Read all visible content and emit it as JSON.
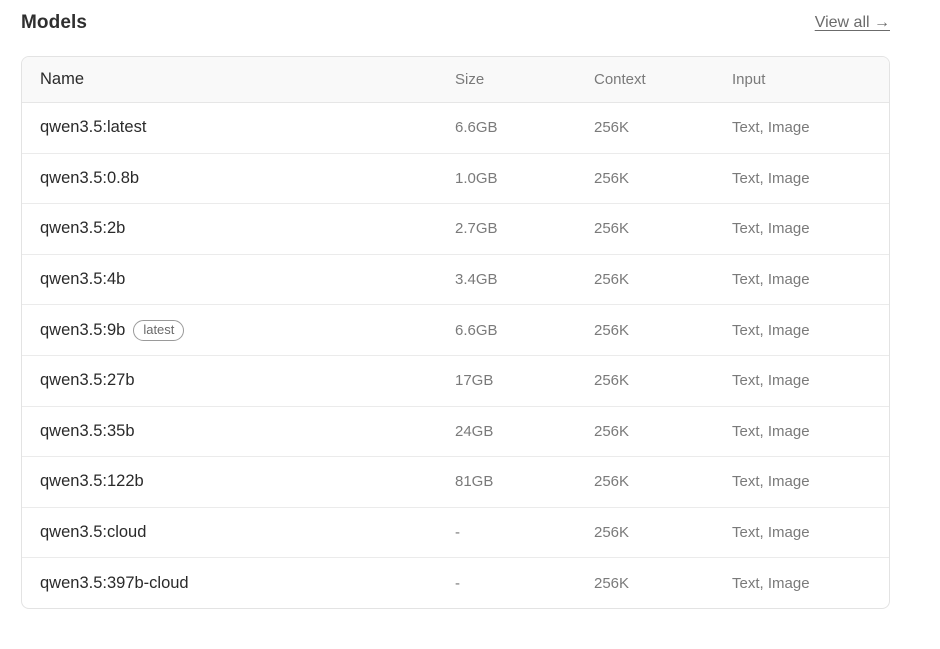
{
  "header": {
    "title": "Models",
    "view_all": "View all →"
  },
  "table": {
    "columns": [
      "Name",
      "Size",
      "Context",
      "Input"
    ],
    "rows": [
      {
        "name": "qwen3.5:latest",
        "badge": "",
        "size": "6.6GB",
        "context": "256K",
        "input": "Text, Image"
      },
      {
        "name": "qwen3.5:0.8b",
        "badge": "",
        "size": "1.0GB",
        "context": "256K",
        "input": "Text, Image"
      },
      {
        "name": "qwen3.5:2b",
        "badge": "",
        "size": "2.7GB",
        "context": "256K",
        "input": "Text, Image"
      },
      {
        "name": "qwen3.5:4b",
        "badge": "",
        "size": "3.4GB",
        "context": "256K",
        "input": "Text, Image"
      },
      {
        "name": "qwen3.5:9b",
        "badge": "latest",
        "size": "6.6GB",
        "context": "256K",
        "input": "Text, Image"
      },
      {
        "name": "qwen3.5:27b",
        "badge": "",
        "size": "17GB",
        "context": "256K",
        "input": "Text, Image"
      },
      {
        "name": "qwen3.5:35b",
        "badge": "",
        "size": "24GB",
        "context": "256K",
        "input": "Text, Image"
      },
      {
        "name": "qwen3.5:122b",
        "badge": "",
        "size": "81GB",
        "context": "256K",
        "input": "Text, Image"
      },
      {
        "name": "qwen3.5:cloud",
        "badge": "",
        "size": "-",
        "context": "256K",
        "input": "Text, Image"
      },
      {
        "name": "qwen3.5:397b-cloud",
        "badge": "",
        "size": "-",
        "context": "256K",
        "input": "Text, Image"
      }
    ]
  }
}
